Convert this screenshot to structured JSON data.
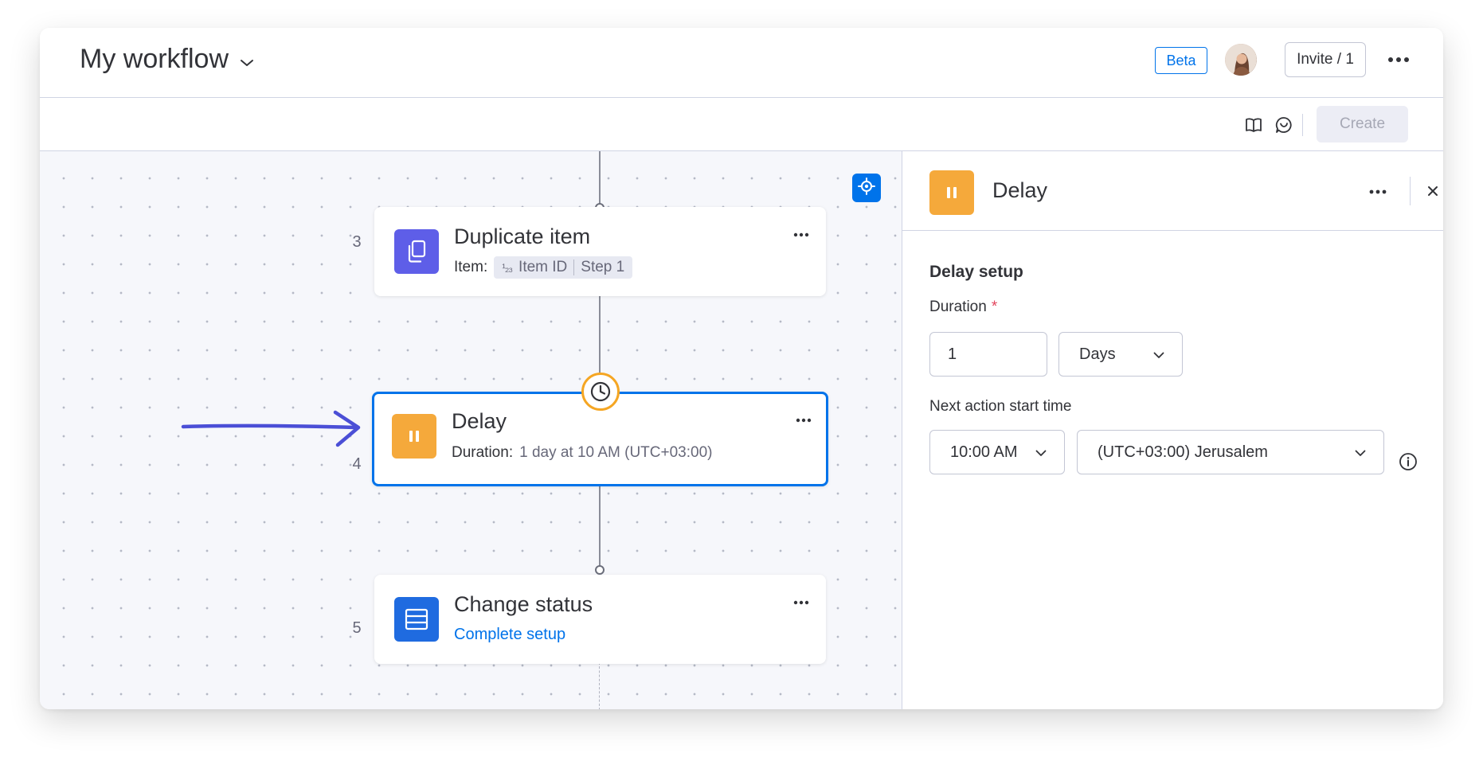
{
  "header": {
    "workflow_title": "My workflow",
    "beta_label": "Beta",
    "invite_label": "Invite / 1"
  },
  "toolbar": {
    "create_label": "Create"
  },
  "canvas": {
    "steps": [
      {
        "number": "3",
        "title": "Duplicate item",
        "subtitle_label": "Item:",
        "chip_type": "¹₂₃",
        "chip_field": "Item ID",
        "chip_source": "Step 1",
        "icon": "duplicate-icon",
        "color": "#5e5ee8"
      },
      {
        "number": "4",
        "title": "Delay",
        "subtitle_label": "Duration:",
        "subtitle_value": "1 day at 10 AM (UTC+03:00)",
        "icon": "pause-icon",
        "color": "#f5a93b",
        "selected": true
      },
      {
        "number": "5",
        "title": "Change status",
        "link_label": "Complete setup",
        "icon": "table-icon",
        "color": "#1f6be0"
      }
    ]
  },
  "panel": {
    "title": "Delay",
    "section_title": "Delay setup",
    "duration_label": "Duration",
    "required_mark": "*",
    "duration_value": "1",
    "duration_unit": "Days",
    "next_action_label": "Next action start time",
    "time_value": "10:00 AM",
    "timezone_value": "(UTC+03:00) Jerusalem"
  },
  "colors": {
    "primary": "#0073ea",
    "delay_orange": "#f5a93b",
    "annotation_arrow": "#4b4fd6"
  }
}
